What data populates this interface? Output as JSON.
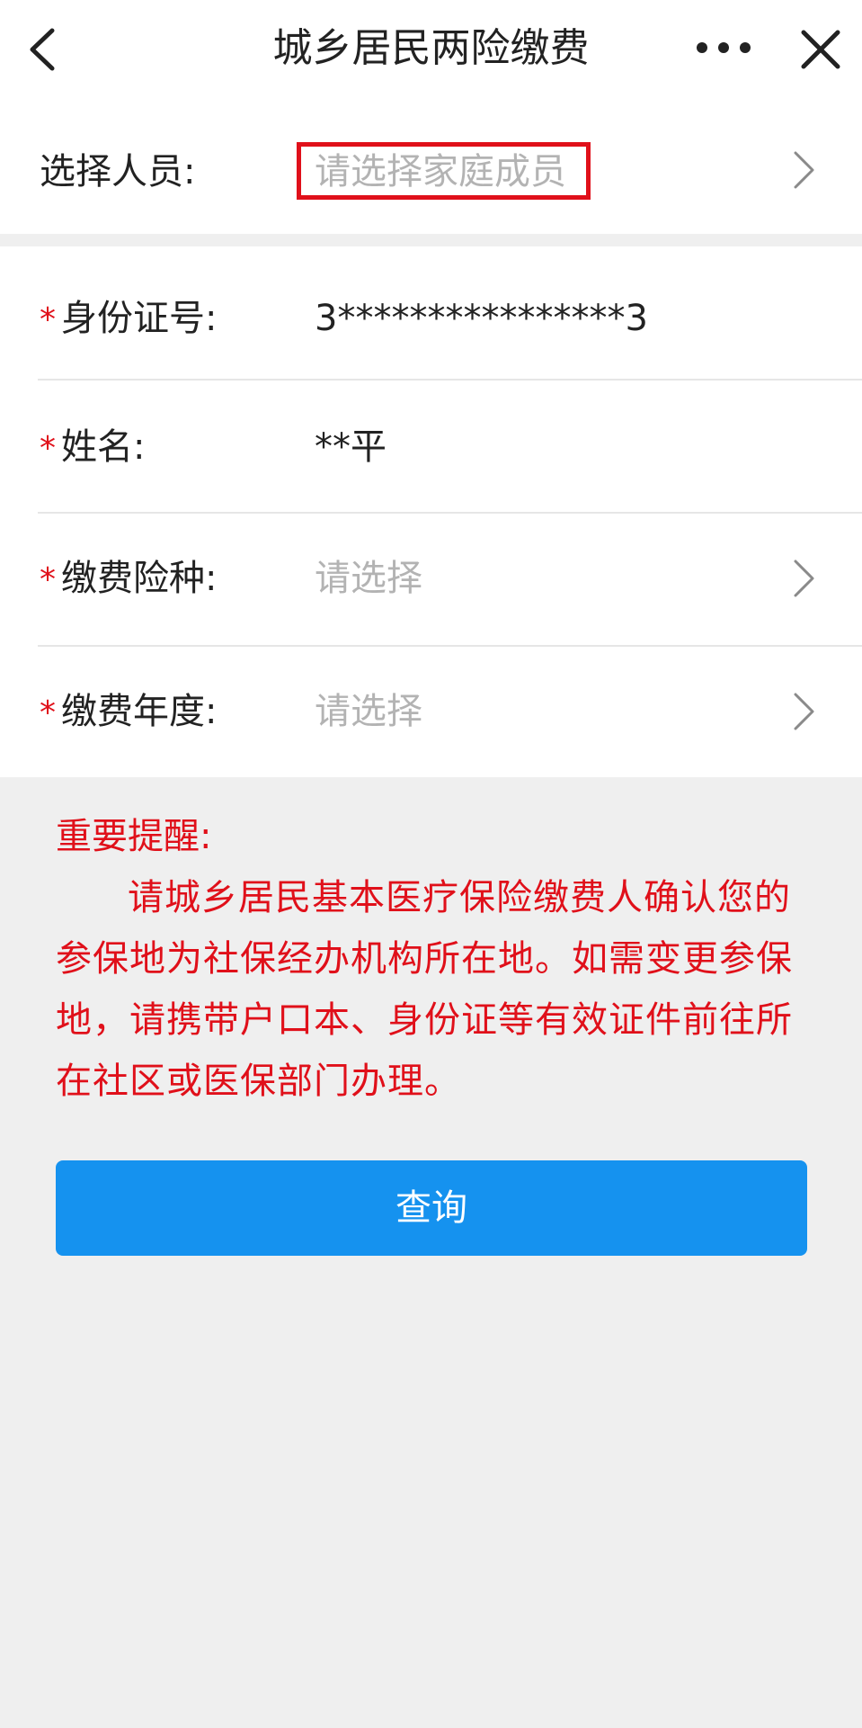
{
  "navbar": {
    "title": "城乡居民两险缴费",
    "back_icon": "chevron-left-icon",
    "more_icon": "more-dots-icon",
    "close_icon": "close-icon"
  },
  "person_select": {
    "label": "选择人员:",
    "placeholder": "请选择家庭成员",
    "highlight_color": "#e0101a"
  },
  "form": {
    "id_number": {
      "required_mark": "*",
      "label": "身份证号:",
      "value": "3****************3"
    },
    "name": {
      "required_mark": "*",
      "label": "姓名:",
      "value": "**平"
    },
    "insurance_type": {
      "required_mark": "*",
      "label": "缴费险种:",
      "placeholder": "请选择"
    },
    "payment_year": {
      "required_mark": "*",
      "label": "缴费年度:",
      "placeholder": "请选择"
    }
  },
  "notice": {
    "title": "重要提醒:",
    "body": "请城乡居民基本医疗保险缴费人确认您的参保地为社保经办机构所在地。如需变更参保地，请携带户口本、身份证等有效证件前往所在社区或医保部门办理。",
    "color": "#e0101a"
  },
  "query_button": {
    "label": "查询",
    "color": "#1592ef"
  }
}
